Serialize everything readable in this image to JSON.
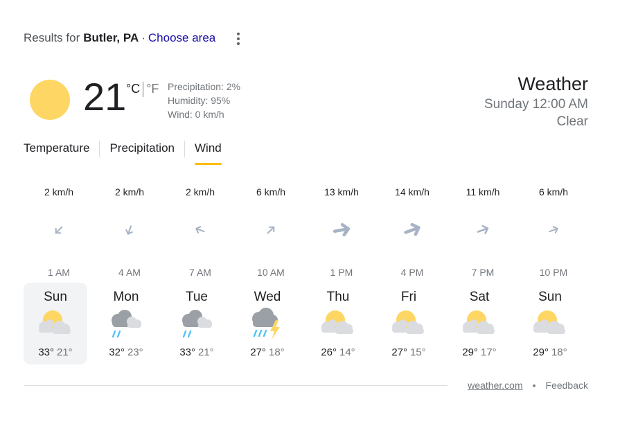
{
  "header": {
    "results_prefix": "Results for",
    "location": "Butler, PA",
    "separator": "·",
    "choose_area": "Choose area",
    "menu_icon": "kebab-menu-icon"
  },
  "current": {
    "icon": "sun-icon",
    "temperature": "21",
    "unit_c": "°C",
    "unit_f": "°F",
    "precipitation": "Precipitation: 2%",
    "humidity": "Humidity: 95%",
    "wind": "Wind: 0 km/h",
    "title": "Weather",
    "datetime": "Sunday 12:00 AM",
    "condition": "Clear"
  },
  "tabs": [
    {
      "label": "Temperature",
      "active": false
    },
    {
      "label": "Precipitation",
      "active": false
    },
    {
      "label": "Wind",
      "active": true
    }
  ],
  "wind": [
    {
      "speed": "2 km/h",
      "time": "1 AM",
      "direction_deg": 225,
      "strength": "light"
    },
    {
      "speed": "2 km/h",
      "time": "4 AM",
      "direction_deg": 200,
      "strength": "light"
    },
    {
      "speed": "2 km/h",
      "time": "7 AM",
      "direction_deg": 290,
      "strength": "light"
    },
    {
      "speed": "6 km/h",
      "time": "10 AM",
      "direction_deg": 45,
      "strength": "light"
    },
    {
      "speed": "13 km/h",
      "time": "1 PM",
      "direction_deg": 80,
      "strength": "strong"
    },
    {
      "speed": "14 km/h",
      "time": "4 PM",
      "direction_deg": 70,
      "strength": "strong"
    },
    {
      "speed": "11 km/h",
      "time": "7 PM",
      "direction_deg": 70,
      "strength": "medium"
    },
    {
      "speed": "6 km/h",
      "time": "10 PM",
      "direction_deg": 70,
      "strength": "light"
    }
  ],
  "forecast": [
    {
      "day": "Sun",
      "icon": "partly-cloudy-icon",
      "high": "33°",
      "low": "21°",
      "selected": true
    },
    {
      "day": "Mon",
      "icon": "rain-icon",
      "high": "32°",
      "low": "23°",
      "selected": false
    },
    {
      "day": "Tue",
      "icon": "rain-icon",
      "high": "33°",
      "low": "21°",
      "selected": false
    },
    {
      "day": "Wed",
      "icon": "thunderstorm-icon",
      "high": "27°",
      "low": "18°",
      "selected": false
    },
    {
      "day": "Thu",
      "icon": "partly-cloudy-icon",
      "high": "26°",
      "low": "14°",
      "selected": false
    },
    {
      "day": "Fri",
      "icon": "partly-cloudy-icon",
      "high": "27°",
      "low": "15°",
      "selected": false
    },
    {
      "day": "Sat",
      "icon": "partly-cloudy-icon",
      "high": "29°",
      "low": "17°",
      "selected": false
    },
    {
      "day": "Sun",
      "icon": "partly-cloudy-icon",
      "high": "29°",
      "low": "18°",
      "selected": false
    }
  ],
  "footer": {
    "source": "weather.com",
    "dot": "•",
    "feedback": "Feedback"
  },
  "colors": {
    "sun": "#fdd663",
    "cloud": "#dadce0",
    "rain": "#4fc3f7",
    "arrow": "#a7b3c5",
    "tab_accent": "#fbbc04",
    "link": "#1a0dab"
  }
}
